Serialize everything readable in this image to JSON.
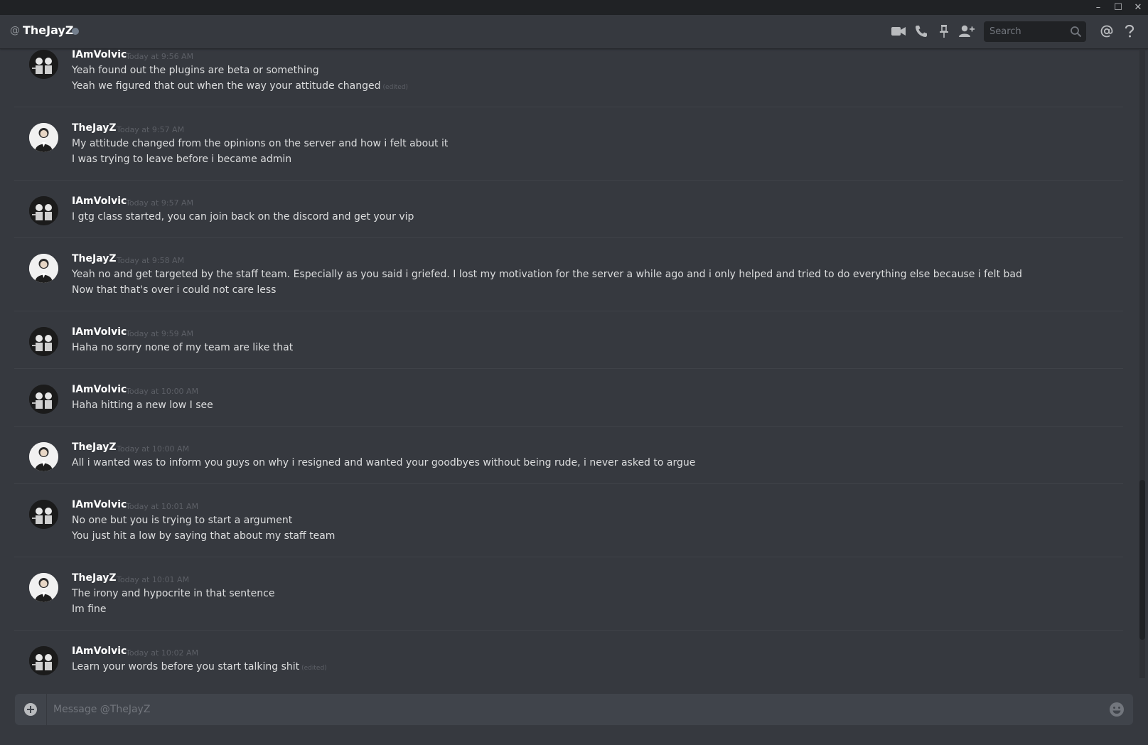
{
  "window": {
    "minimize_glyph": "–",
    "maximize_glyph": "☐",
    "close_glyph": "✕"
  },
  "header": {
    "at_symbol": "@",
    "channel_name": "TheJayZ",
    "status_color": "#747f8d",
    "icons": [
      "video-call-icon",
      "voice-call-icon",
      "pin-icon",
      "add-friend-icon",
      "mention-icon",
      "help-icon"
    ],
    "search": {
      "placeholder": "Search",
      "value": ""
    }
  },
  "messages": [
    {
      "user": "IAmVolvic",
      "avatar": "iamvolvic-avatar",
      "timestamp": "Today at 9:56 AM",
      "lines": [
        {
          "text": "Yeah found out the plugins are beta or something",
          "edited": ""
        },
        {
          "text": "Yeah we figured that out when the way your attitude changed",
          "edited": "(edited)"
        }
      ]
    },
    {
      "user": "TheJayZ",
      "avatar": "thejayz-avatar",
      "timestamp": "Today at 9:57 AM",
      "lines": [
        {
          "text": "My attitude changed from the opinions on the server and how i felt about it",
          "edited": ""
        },
        {
          "text": "I was trying to leave before i became admin",
          "edited": ""
        }
      ]
    },
    {
      "user": "IAmVolvic",
      "avatar": "iamvolvic-avatar",
      "timestamp": "Today at 9:57 AM",
      "lines": [
        {
          "text": "I gtg class started, you can join back on the discord and get your vip",
          "edited": ""
        }
      ]
    },
    {
      "user": "TheJayZ",
      "avatar": "thejayz-avatar",
      "timestamp": "Today at 9:58 AM",
      "lines": [
        {
          "text": "Yeah no and get targeted by the staff team. Especially as you said i griefed. I lost my motivation for the server a while ago and i only helped and tried to do everything else because i felt bad",
          "edited": ""
        },
        {
          "text": "Now that that's over i could not care less",
          "edited": ""
        }
      ]
    },
    {
      "user": "IAmVolvic",
      "avatar": "iamvolvic-avatar",
      "timestamp": "Today at 9:59 AM",
      "lines": [
        {
          "text": "Haha no sorry none of my team are like that",
          "edited": ""
        }
      ]
    },
    {
      "user": "IAmVolvic",
      "avatar": "iamvolvic-avatar",
      "timestamp": "Today at 10:00 AM",
      "lines": [
        {
          "text": "Haha hitting a new low I see",
          "edited": ""
        }
      ]
    },
    {
      "user": "TheJayZ",
      "avatar": "thejayz-avatar",
      "timestamp": "Today at 10:00 AM",
      "lines": [
        {
          "text": "All i wanted was to inform you guys on why i resigned and wanted your goodbyes without being rude, i never asked to argue",
          "edited": ""
        }
      ]
    },
    {
      "user": "IAmVolvic",
      "avatar": "iamvolvic-avatar",
      "timestamp": "Today at 10:01 AM",
      "lines": [
        {
          "text": "No one but you is trying to start a argument",
          "edited": ""
        },
        {
          "text": "You just hit a low by saying that about my staff team",
          "edited": ""
        }
      ]
    },
    {
      "user": "TheJayZ",
      "avatar": "thejayz-avatar",
      "timestamp": "Today at 10:01 AM",
      "lines": [
        {
          "text": "The irony and hypocrite in that sentence",
          "edited": ""
        },
        {
          "text": "Im fine",
          "edited": ""
        }
      ]
    },
    {
      "user": "IAmVolvic",
      "avatar": "iamvolvic-avatar",
      "timestamp": "Today at 10:02 AM",
      "lines": [
        {
          "text": "Learn your words before you start talking shit",
          "edited": "(edited)"
        }
      ]
    }
  ],
  "composer": {
    "placeholder": "Message @TheJayZ",
    "value": ""
  }
}
